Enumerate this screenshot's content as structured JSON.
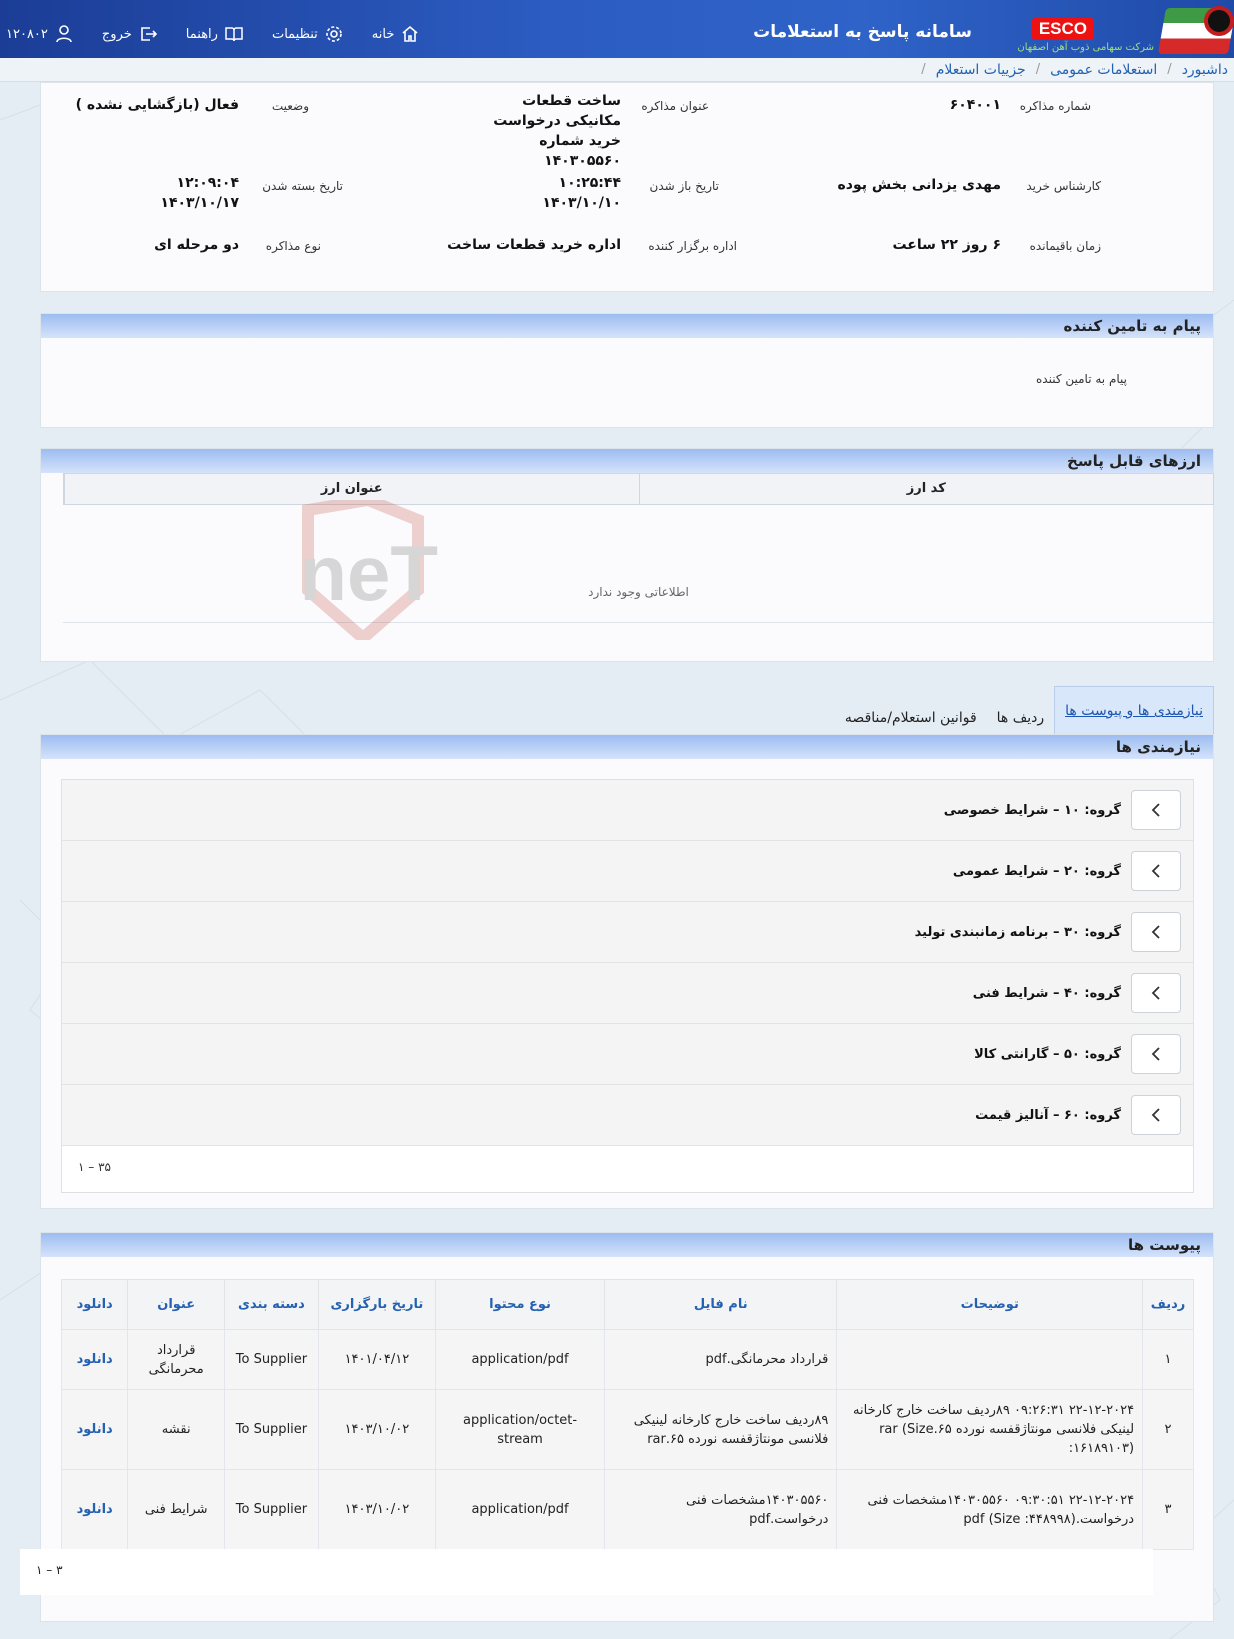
{
  "header": {
    "system_title": "سامانه پاسخ به استعلامات",
    "brand_name": "ESCO",
    "brand_subtitle": "شرکت سهامی ذوب آهن اصفهان",
    "nav": {
      "home": "خانه",
      "settings": "تنظیمات",
      "guide": "راهنما",
      "logout": "خروج",
      "user_id": "۱۲۰۸۰۲"
    }
  },
  "breadcrumb": [
    "داشبورد",
    "استعلامات عمومی",
    "جزییات استعلام"
  ],
  "info": {
    "negotiation_number_label": "شماره مذاکره",
    "negotiation_number": "۶۰۴۰۰۱",
    "negotiation_title_label": "عنوان مذاکره",
    "negotiation_title": "ساخت قطعات مکانیکی درخواست خرید شماره ۱۴۰۳۰۵۵۶۰",
    "status_label": "وضعیت",
    "status": "فعال (بازگشایی نشده )",
    "buyer_label": "کارشناس خرید",
    "buyer": "مهدی یزدانی بخش پوده",
    "open_date_label": "تاریخ باز شدن",
    "open_time": "۱۰:۲۵:۴۴",
    "open_date": "۱۴۰۳/۱۰/۱۰",
    "close_date_label": "تاریخ بسته شدن",
    "close_time": "۱۲:۰۹:۰۴",
    "close_date": "۱۴۰۳/۱۰/۱۷",
    "remaining_label": "زمان باقیمانده",
    "remaining": "۶ روز ۲۲ ساعت",
    "organizer_label": "اداره برگزار کننده",
    "organizer": "اداره خرید قطعات ساخت",
    "type_label": "نوع مذاکره",
    "type": "دو مرحله ای"
  },
  "supplier_message": {
    "title": "پیام به تامین کننده",
    "body": "پیام به تامین کننده"
  },
  "currencies": {
    "title": "ارزهای قابل پاسخ",
    "columns": [
      "کد ارز",
      "عنوان ارز"
    ],
    "empty_text": "اطلاعاتی وجود ندارد"
  },
  "watermark_text": "AriaTender.neT",
  "tabs": [
    "نیازمندی ها و پیوست ها",
    "ردیف ها",
    "قوانین استعلام/مناقصه"
  ],
  "requirements": {
    "title": "نیازمندی ها",
    "items": [
      "گروه: ۱۰ – شرایط خصوصی",
      "گروه: ۲۰ – شرایط عمومی",
      "گروه: ۳۰ – برنامه زمانبندی تولید",
      "گروه: ۴۰ – شرایط فنی",
      "گروه: ۵۰ – گارانتی کالا",
      "گروه: ۶۰ – آنالیز قیمت"
    ],
    "pager": "۱ – ۳۵"
  },
  "attachments": {
    "title": "پیوست ها",
    "columns": [
      "ردیف",
      "توضیحات",
      "نام فایل",
      "نوع محتوا",
      "تاریخ بارگزاری",
      "دسته بندی",
      "عنوان",
      "دانلود"
    ],
    "rows": [
      {
        "row": "۱",
        "description": "",
        "file_name": "قرارداد محرمانگی.pdf",
        "content_type": "application/pdf",
        "upload_date": "۱۴۰۱/۰۴/۱۲",
        "category": "To Supplier",
        "title": "قرارداد محرمانگی",
        "download": "دانلود"
      },
      {
        "row": "۲",
        "description": "۲۲-۱۲-۲۰۲۴ ۰۹:۲۶:۳۱ ۸۹ردیف ساخت خارج کارخانه لینیکی فلانسی مونتاژقفسه نورده ۶۵.rar (Size :۱۶۱۸۹۱۰۳)",
        "file_name": "۸۹ردیف ساخت خارج کارخانه لینیکی فلانسی مونتاژقفسه نورده ۶۵.rar",
        "content_type": "application/octet-stream",
        "upload_date": "۱۴۰۳/۱۰/۰۲",
        "category": "To Supplier",
        "title": "نقشه",
        "download": "دانلود"
      },
      {
        "row": "۳",
        "description": "۲۲-۱۲-۲۰۲۴ ۰۹:۳۰:۵۱ ۱۴۰۳۰۵۵۶۰مشخصات فنی درخواست.pdf (Size :۴۴۸۹۹۸)",
        "file_name": "۱۴۰۳۰۵۵۶۰مشخصات فنی درخواست.pdf",
        "content_type": "application/pdf",
        "upload_date": "۱۴۰۳/۱۰/۰۲",
        "category": "To Supplier",
        "title": "شرایط فنی",
        "download": "دانلود"
      }
    ],
    "pager": "۱ – ۳"
  },
  "colors": {
    "header_blue": "#2c5cc2",
    "link_blue": "#2461b2",
    "panel_head": "#9dbcf0",
    "brand_red": "#e11111"
  }
}
